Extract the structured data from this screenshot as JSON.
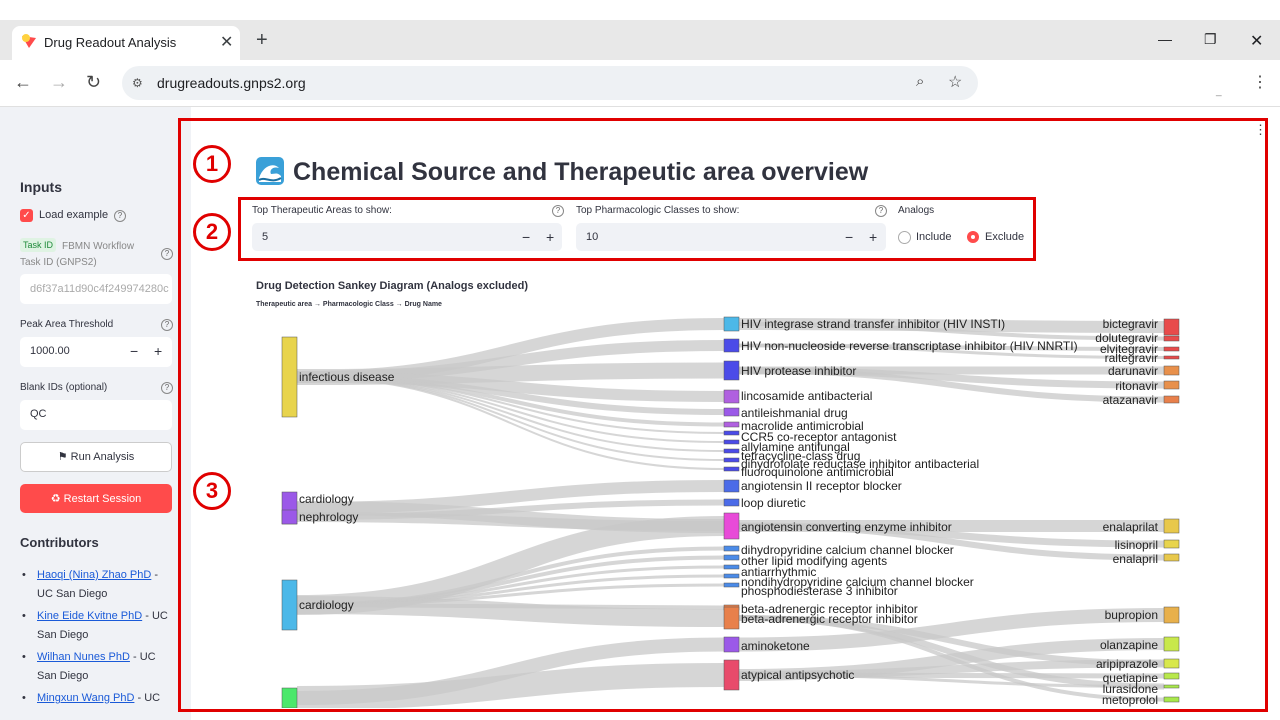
{
  "browser": {
    "tab_title": "Drug Readout Analysis",
    "url": "drugreadouts.gnps2.org"
  },
  "sidebar": {
    "inputs_heading": "Inputs",
    "load_example_label": "Load example",
    "task_id_badge": "Task ID",
    "task_id_label": "FBMN Workflow Task ID (GNPS2)",
    "task_id_value": "d6f37a11d90c4f249974280c",
    "peak_area_label": "Peak Area Threshold",
    "peak_area_value": "1000.00",
    "blank_ids_label": "Blank IDs (optional)",
    "blank_ids_value": "QC",
    "run_button": "Run Analysis",
    "restart_button": "Restart Session",
    "contributors_heading": "Contributors",
    "contributors": [
      {
        "name": "Haoqi (Nina) Zhao PhD",
        "aff1": " -",
        "aff2": "UC San Diego"
      },
      {
        "name": "Kine Eide Kvitne PhD",
        "aff1": " - UC",
        "aff2": "San Diego"
      },
      {
        "name": "Wilhan Nunes PhD",
        "aff1": " - UC",
        "aff2": "San Diego"
      },
      {
        "name": "Mingxun Wang PhD",
        "aff1": " - UC",
        "aff2": ""
      }
    ]
  },
  "main": {
    "title": "Chemical Source and Therapeutic area overview",
    "annotations": [
      "1",
      "2",
      "3"
    ],
    "controls": {
      "top_areas_label": "Top Therapeutic Areas to show:",
      "top_areas_value": "5",
      "top_classes_label": "Top Pharmacologic Classes to show:",
      "top_classes_value": "10",
      "analogs_label": "Analogs",
      "include_label": "Include",
      "exclude_label": "Exclude",
      "analogs_selected": "Exclude"
    },
    "chart_title": "Drug Detection Sankey Diagram (Analogs excluded)",
    "chart_subtitle": "Therapeutic area → Pharmacologic Class → Drug Name"
  },
  "sankey": {
    "areas": [
      {
        "label": "infectious disease",
        "color": "#e8d44d"
      },
      {
        "label": "cardiology",
        "color": "#9b59e8"
      },
      {
        "label": "nephrology",
        "color": "#9b59e8"
      },
      {
        "label": "cardiology",
        "color": "#4cb8e8"
      }
    ],
    "classes": [
      {
        "label": "HIV integrase strand transfer inhibitor (HIV INSTI)",
        "color": "#4cb8e8"
      },
      {
        "label": "HIV non-nucleoside reverse transcriptase inhibitor (HIV NNRTI)",
        "color": "#4b4be8"
      },
      {
        "label": "HIV protease inhibitor",
        "color": "#4b4be8"
      },
      {
        "label": "lincosamide antibacterial",
        "color": "#b060e0"
      },
      {
        "label": "antileishmanial drug",
        "color": "#9b59e8"
      },
      {
        "label": "macrolide antimicrobial",
        "color": "#b060e0"
      },
      {
        "label": "CCR5 co-receptor antagonist",
        "color": "#4b4be8"
      },
      {
        "label": "allylamine antifungal",
        "color": "#4b4be8"
      },
      {
        "label": "tetracycline-class drug",
        "color": "#4b4be8"
      },
      {
        "label": "dihydrofolate reductase inhibitor antibacterial",
        "color": "#4b4be8"
      },
      {
        "label": "fluoroquinolone antimicrobial",
        "color": "#4b4be8"
      },
      {
        "label": "angiotensin II receptor blocker",
        "color": "#4b6be8"
      },
      {
        "label": "loop diuretic",
        "color": "#4b6be8"
      },
      {
        "label": "angiotensin converting enzyme inhibitor",
        "color": "#e84bd8"
      },
      {
        "label": "dihydropyridine calcium channel blocker",
        "color": "#4b8be8"
      },
      {
        "label": "other lipid modifying agents",
        "color": "#4b8be8"
      },
      {
        "label": "antiarrhythmic",
        "color": "#4b8be8"
      },
      {
        "label": "nondihydropyridine calcium channel blocker",
        "color": "#4b8be8"
      },
      {
        "label": "phosphodiesterase 3 inhibitor",
        "color": "#4b8be8"
      },
      {
        "label": "beta-adrenergic receptor inhibitor",
        "color": "#e8804b"
      },
      {
        "label": "beta-adrenergic receptor inhibitor",
        "color": "#e8804b"
      },
      {
        "label": "aminoketone",
        "color": "#9b59e8"
      },
      {
        "label": "atypical antipsychotic",
        "color": "#e84b6b"
      }
    ],
    "drugs": [
      {
        "label": "bictegravir",
        "color": "#e84b4b"
      },
      {
        "label": "dolutegravir",
        "color": "#e84b4b"
      },
      {
        "label": "elvitegravir",
        "color": "#e84b4b"
      },
      {
        "label": "raltegravir",
        "color": "#e84b4b"
      },
      {
        "label": "darunavir",
        "color": "#e8904b"
      },
      {
        "label": "ritonavir",
        "color": "#e8904b"
      },
      {
        "label": "atazanavir",
        "color": "#e8804b"
      },
      {
        "label": "enalaprilat",
        "color": "#e8c84b"
      },
      {
        "label": "lisinopril",
        "color": "#e8d44d"
      },
      {
        "label": "enalapril",
        "color": "#e8c84b"
      },
      {
        "label": "bupropion",
        "color": "#e8b04b"
      },
      {
        "label": "olanzapine",
        "color": "#c8e84b"
      },
      {
        "label": "aripiprazole",
        "color": "#d8e84b"
      },
      {
        "label": "quetiapine",
        "color": "#b8e84b"
      },
      {
        "label": "lurasidone",
        "color": "#a8e84b"
      },
      {
        "label": "metoprolol",
        "color": "#a8e84b"
      }
    ]
  }
}
